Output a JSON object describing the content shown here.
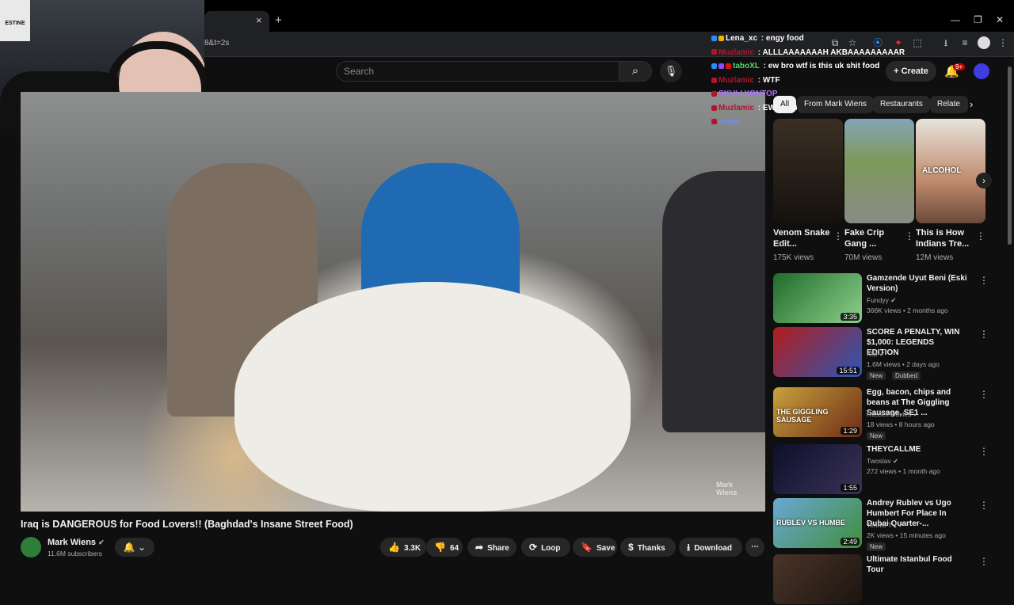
{
  "browser": {
    "url_fragment": "8&t=2s",
    "tab_close": "×",
    "new_tab": "+"
  },
  "webcam": {
    "sign_text": "ESTINE"
  },
  "header": {
    "search_placeholder": "Search",
    "create_label": "Create",
    "notification_count": "9+"
  },
  "chat": [
    {
      "user": "Lena_xc",
      "message": "engy food",
      "color": "#ffffff",
      "badge_colors": [
        "#2a8cff",
        "#f5b400"
      ]
    },
    {
      "user": "Muzlamic",
      "message": "ALLLAAAAAAAH AKBAAAAAAAAAR",
      "color": "#b0162a",
      "badge_colors": [
        "#b0162a"
      ]
    },
    {
      "user": "taboXL",
      "message": "ew bro wtf is this uk shit food",
      "color": "#59d66b",
      "badge_colors": [
        "#2a8cff",
        "#9147ff",
        "#d11"
      ]
    },
    {
      "user": "Muzlamic",
      "message": "WTF",
      "color": "#b0162a",
      "badge_colors": [
        "#b0162a"
      ]
    },
    {
      "user": "SKULLYONTOP",
      "message": "",
      "color": "#a970ff",
      "badge_colors": [
        "#b0162a"
      ]
    },
    {
      "user": "Muzlamic",
      "message": "EWWWWWWW",
      "color": "#b0162a",
      "badge_colors": [
        "#b0162a"
      ]
    },
    {
      "user": "cecee",
      "message": "",
      "color": "#6b8cff",
      "badge_colors": [
        "#b0162a"
      ]
    }
  ],
  "chips": [
    "All",
    "From Mark Wiens",
    "Restaurants",
    "Relate"
  ],
  "shorts": [
    {
      "title": "Venom Snake Edit...",
      "views": "175K views",
      "thumb_text": ""
    },
    {
      "title": "Fake Crip Gang ...",
      "views": "70M views",
      "thumb_text": ""
    },
    {
      "title": "This is How Indians Tre...",
      "views": "12M views",
      "thumb_text": "ALCOHOL"
    }
  ],
  "recommendations": [
    {
      "title": "Gamzende Uyut Beni (Eski Version)",
      "channel": "Fundyy",
      "meta": "366K views • 2 months ago",
      "duration": "3:35",
      "badges": []
    },
    {
      "title": "SCORE A PENALTY, WIN $1,000: LEGENDS EDITION",
      "channel": "KSI",
      "meta": "1.6M views • 2 days ago",
      "duration": "15:51",
      "badges": [
        "New",
        "Dubbed"
      ]
    },
    {
      "title": "Egg, bacon, chips and beans at The Giggling Sausage, SE1 ...",
      "channel": "Russell Davies",
      "meta": "18 views • 8 hours ago",
      "duration": "1:29",
      "badges": [
        "New"
      ],
      "thumb_text": "THE GIGGLING SAUSAGE"
    },
    {
      "title": "THEYCALLME",
      "channel": "Twoslav",
      "meta": "272 views • 1 month ago",
      "duration": "1:55",
      "badges": []
    },
    {
      "title": "Andrey Rublev vs Ugo Humbert For Place In Dubai Quarter-...",
      "channel": "Tennis TV",
      "meta": "2K views • 15 minutes ago",
      "duration": "2:49",
      "badges": [
        "New"
      ],
      "thumb_text": "RUBLEV VS HUMBE"
    },
    {
      "title": "Ultimate Istanbul Food Tour",
      "channel": "",
      "meta": "",
      "duration": "",
      "badges": []
    }
  ],
  "video": {
    "title": "Iraq is DANGEROUS for Food Lovers!! (Baghdad's Insane Street Food)",
    "watermark_line1": "Mark",
    "watermark_line2": "Wiens"
  },
  "channel": {
    "name": "Mark Wiens",
    "subscribers": "11.6M subscribers"
  },
  "actions": {
    "likes": "3.3K",
    "dislikes": "64",
    "share": "Share",
    "loop": "Loop",
    "save": "Save",
    "thanks": "Thanks",
    "download": "Download"
  }
}
